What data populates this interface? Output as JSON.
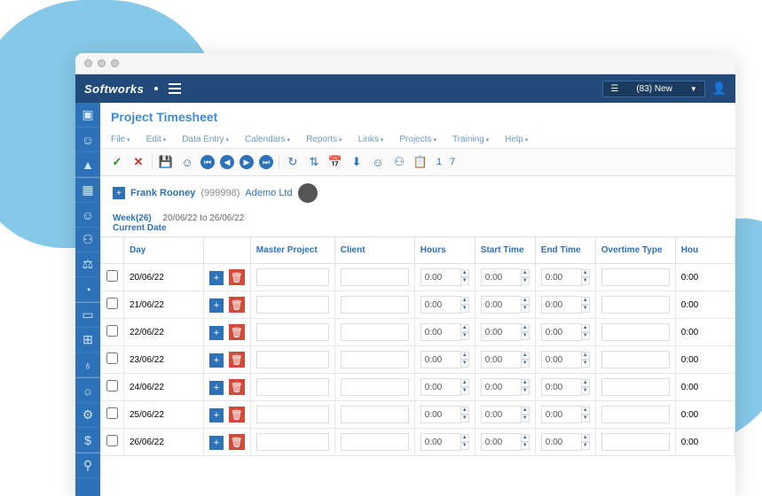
{
  "header": {
    "logo": "Softworks",
    "dropdown": "(83) New",
    "user_icon": "user"
  },
  "page_title": "Project Timesheet",
  "menubar": [
    "File",
    "Edit",
    "Data Entry",
    "Calendars",
    "Reports",
    "Links",
    "Projects",
    "Training",
    "Help"
  ],
  "toolbar_nums": {
    "a": "1",
    "b": "7"
  },
  "employee": {
    "name": "Frank Rooney",
    "id": "(999998)",
    "company": "Ademo Ltd"
  },
  "week": {
    "label": "Week(26)",
    "range": "20/06/22 to 26/06/22",
    "current": "Current Date"
  },
  "columns": {
    "day": "Day",
    "master": "Master Project",
    "client": "Client",
    "hours": "Hours",
    "start": "Start Time",
    "end": "End Time",
    "overtime": "Overtime Type",
    "hours2": "Hou"
  },
  "rows": [
    {
      "date": "20/06/22",
      "hours": "0:00",
      "start": "0:00",
      "end": "0:00",
      "h2": "0:00"
    },
    {
      "date": "21/06/22",
      "hours": "0:00",
      "start": "0:00",
      "end": "0:00",
      "h2": "0:00"
    },
    {
      "date": "22/06/22",
      "hours": "0:00",
      "start": "0:00",
      "end": "0:00",
      "h2": "0:00"
    },
    {
      "date": "23/06/22",
      "hours": "0:00",
      "start": "0:00",
      "end": "0:00",
      "h2": "0:00"
    },
    {
      "date": "24/06/22",
      "hours": "0:00",
      "start": "0:00",
      "end": "0:00",
      "h2": "0:00"
    },
    {
      "date": "25/06/22",
      "hours": "0:00",
      "start": "0:00",
      "end": "0:00",
      "h2": "0:00"
    },
    {
      "date": "26/06/22",
      "hours": "0:00",
      "start": "0:00",
      "end": "0:00",
      "h2": "0:00"
    }
  ]
}
